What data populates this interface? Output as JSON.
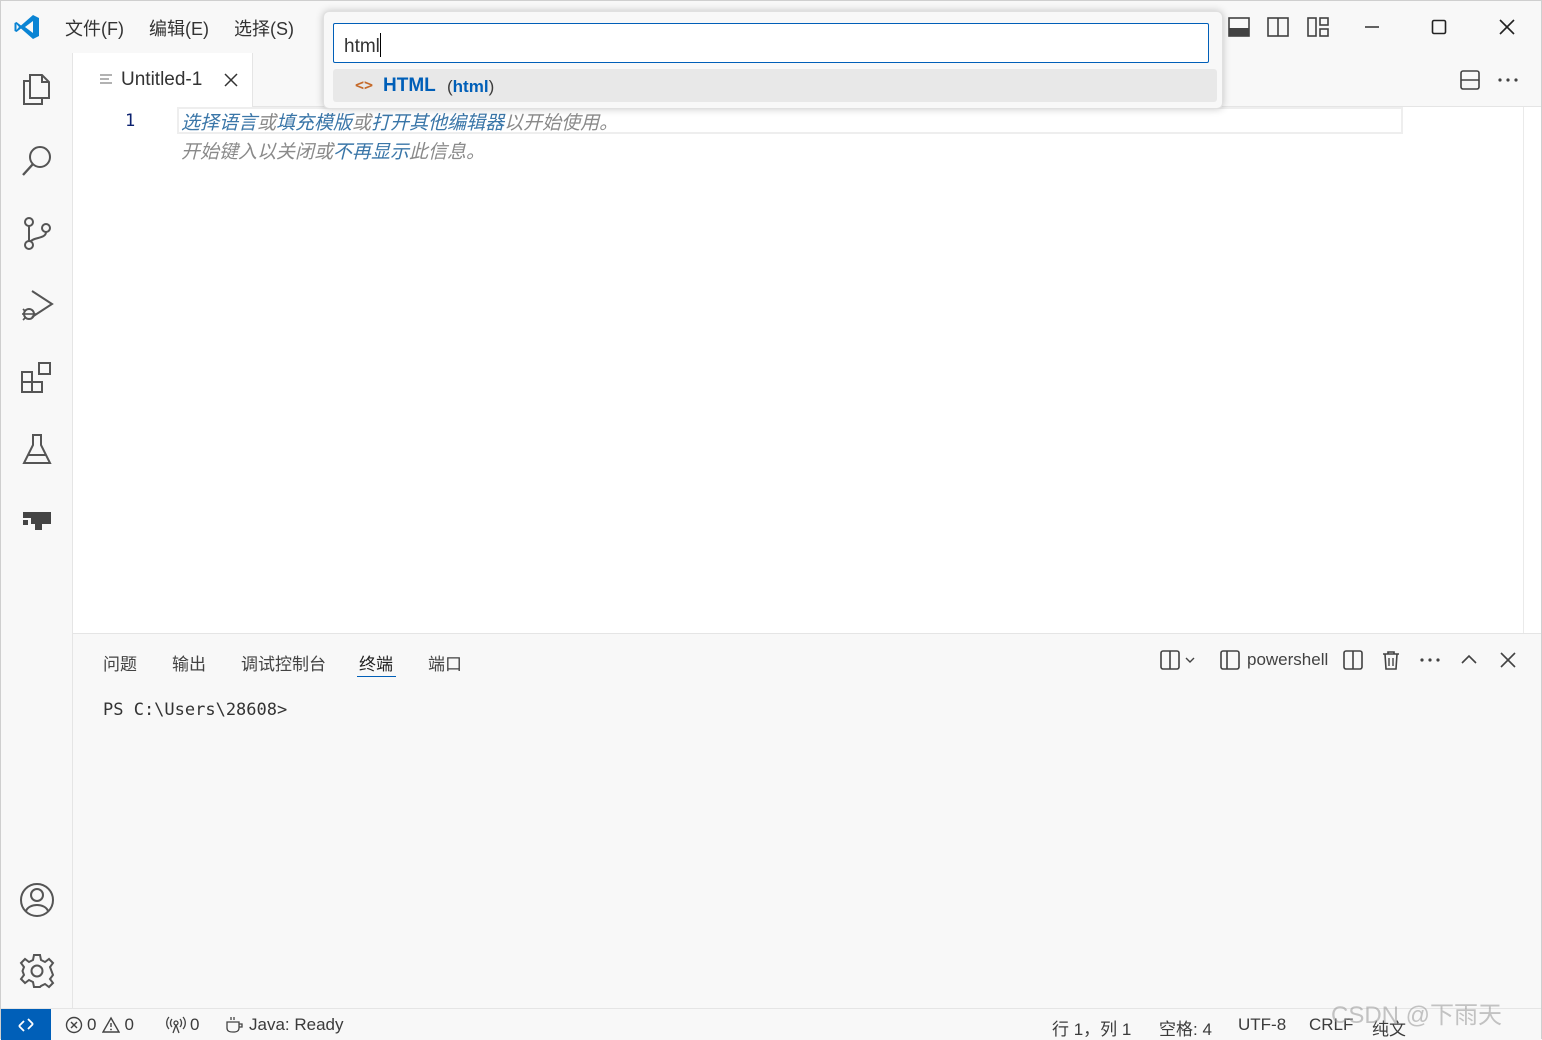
{
  "menu": {
    "file": "文件(F)",
    "edit": "编辑(E)",
    "select": "选择(S)"
  },
  "quick_pick": {
    "input_value": "html",
    "items": [
      {
        "label": "HTML",
        "description_open": "(",
        "description": "html",
        "description_close": ")",
        "icon": "code-brackets-icon"
      }
    ]
  },
  "editor": {
    "tab_title": "Untitled-1",
    "line_number": "1",
    "hint_line1": [
      "选择语言",
      "或",
      "填充模版",
      "或",
      "打开其他编辑器",
      "以开始使用。"
    ],
    "hint_line2": [
      "开始键入以关闭或",
      "不再显示",
      "此信息。"
    ]
  },
  "panel": {
    "tabs": [
      "问题",
      "输出",
      "调试控制台",
      "终端",
      "端口"
    ],
    "active_tab": "终端",
    "terminal_name": "powershell",
    "prompt": "PS C:\\Users\\28608>"
  },
  "status": {
    "errors": "0",
    "warnings": "0",
    "ports": "0",
    "java": "Java: Ready",
    "position": "行 1，列 1",
    "spaces": "空格: 4",
    "encoding": "UTF-8",
    "eol": "CRLF",
    "language": "纯文"
  },
  "watermark": "CSDN @下雨天",
  "colors": {
    "accent": "#005fb8",
    "html_icon": "#c56a2a",
    "hint_link": "#3a76a8"
  }
}
